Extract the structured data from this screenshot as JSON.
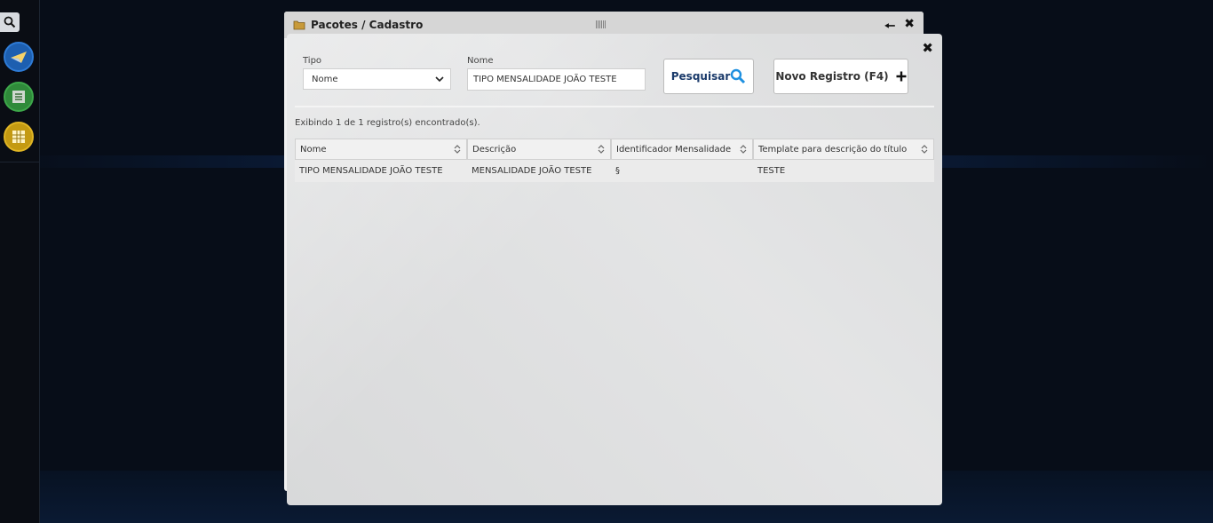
{
  "back_window": {
    "title": "Pacotes / Cadastro"
  },
  "filters": {
    "tipo_label": "Tipo",
    "tipo_value": "Nome",
    "nome_label": "Nome",
    "nome_value": "TIPO MENSALIDADE JOÃO TESTE"
  },
  "buttons": {
    "search_label": "Pesquisar",
    "new_label": "Novo Registro (F4)"
  },
  "result_text": "Exibindo 1 de 1 registro(s) encontrado(s).",
  "table": {
    "columns": [
      "Nome",
      "Descrição",
      "Identificador Mensalidade",
      "Template para descrição do título"
    ],
    "rows": [
      [
        "TIPO MENSALIDADE JOÃO TESTE",
        "MENSALIDADE JOÃO TESTE",
        "§",
        "TESTE"
      ]
    ]
  },
  "icons": {
    "back_window_icon": "folder-icon",
    "sidebar": [
      "search-icon",
      "plane-icon",
      "list-icon",
      "calculator-icon"
    ]
  },
  "colors": {
    "page_bg": "#070d18",
    "dialog_bg": "#dfe0e1",
    "search_icon": "#1e90e0"
  }
}
